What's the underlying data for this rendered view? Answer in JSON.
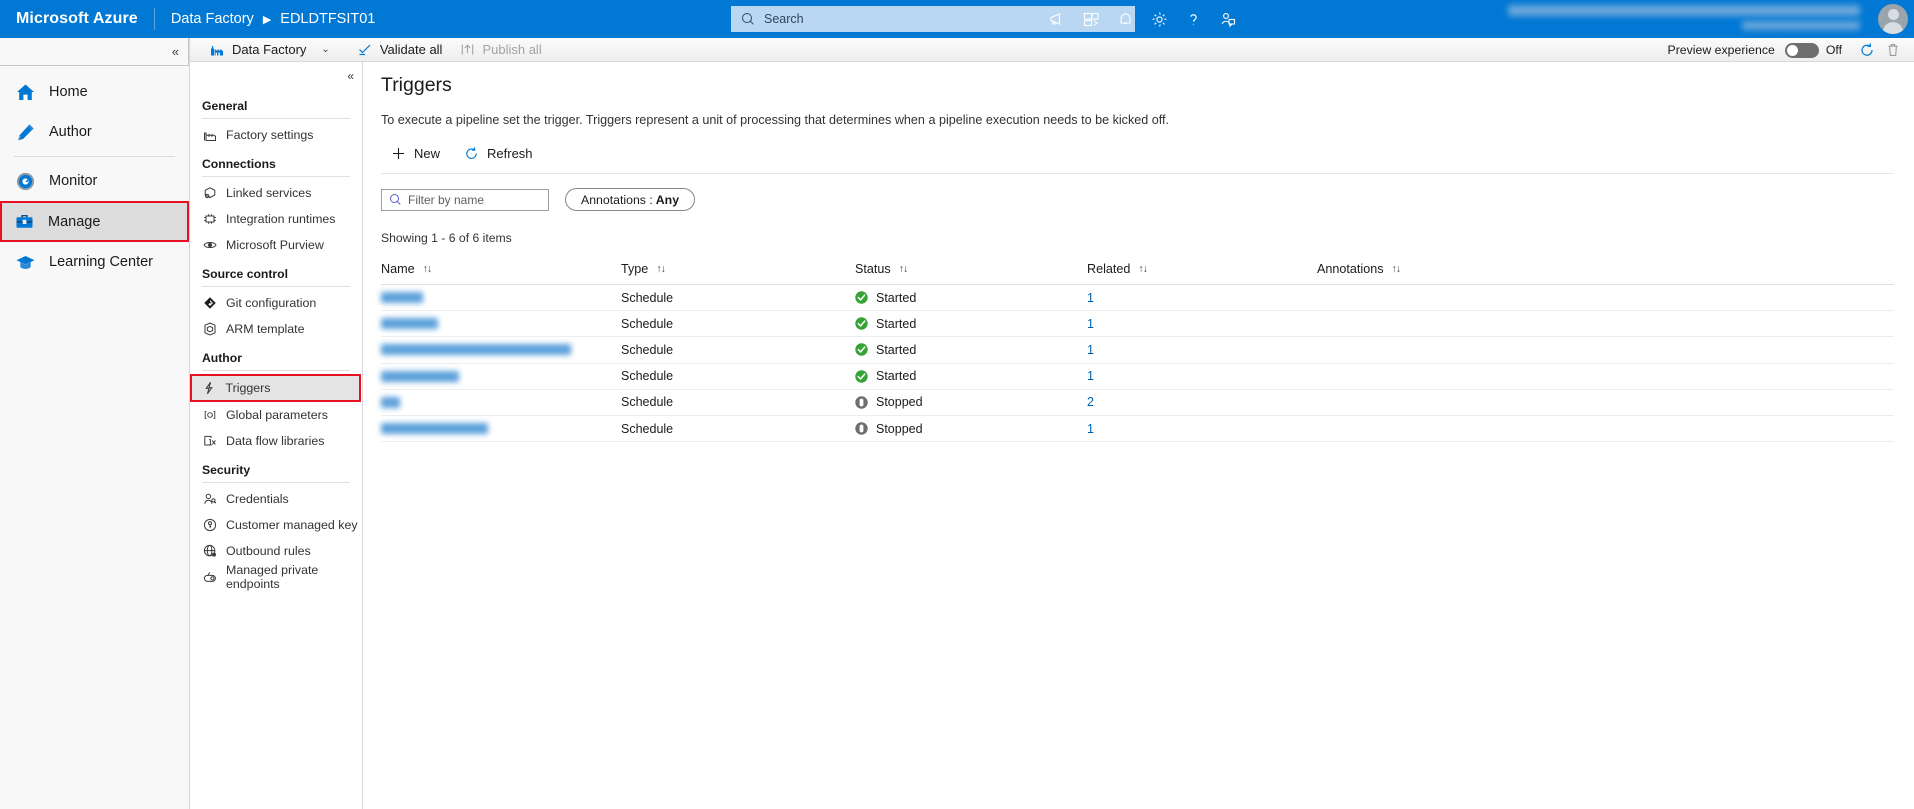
{
  "header": {
    "brand": "Microsoft Azure",
    "breadcrumb_service": "Data Factory",
    "breadcrumb_sep": "▶",
    "breadcrumb_resource": "EDLDTFSIT01",
    "search_placeholder": "Search",
    "icons": [
      {
        "name": "feedback-icon",
        "label": "Feedback"
      },
      {
        "name": "cloud-shell-icon",
        "label": "Cloud Shell"
      },
      {
        "name": "notifications-bell-icon",
        "label": "Notifications"
      },
      {
        "name": "settings-gear-icon",
        "label": "Settings"
      },
      {
        "name": "help-question-icon",
        "label": "Help"
      },
      {
        "name": "support-person-icon",
        "label": "Support"
      }
    ]
  },
  "leftnav": {
    "collapse_chevron": "«",
    "items": [
      {
        "label": "Home",
        "icon": "home-icon"
      },
      {
        "label": "Author",
        "icon": "pencil-icon"
      },
      {
        "label": "Monitor",
        "icon": "monitor-gauge-icon"
      },
      {
        "label": "Manage",
        "icon": "toolbox-icon",
        "selected": true
      },
      {
        "label": "Learning Center",
        "icon": "graduation-cap-icon"
      }
    ]
  },
  "panel": {
    "collapse_chevron": "«",
    "groups": [
      {
        "title": "General",
        "items": [
          {
            "label": "Factory settings",
            "icon": "factory-icon"
          }
        ]
      },
      {
        "title": "Connections",
        "items": [
          {
            "label": "Linked services",
            "icon": "linked-services-icon"
          },
          {
            "label": "Integration runtimes",
            "icon": "integration-runtime-icon"
          },
          {
            "label": "Microsoft Purview",
            "icon": "purview-eye-icon"
          }
        ]
      },
      {
        "title": "Source control",
        "items": [
          {
            "label": "Git configuration",
            "icon": "git-diamond-icon"
          },
          {
            "label": "ARM template",
            "icon": "arm-template-cube-icon"
          }
        ]
      },
      {
        "title": "Author",
        "items": [
          {
            "label": "Triggers",
            "icon": "lightning-bolt-icon",
            "selected": true
          },
          {
            "label": "Global parameters",
            "icon": "global-parameter-icon"
          },
          {
            "label": "Data flow libraries",
            "icon": "data-flow-library-icon"
          }
        ]
      },
      {
        "title": "Security",
        "items": [
          {
            "label": "Credentials",
            "icon": "credentials-person-key-icon"
          },
          {
            "label": "Customer managed key",
            "icon": "key-shield-icon"
          },
          {
            "label": "Outbound rules",
            "icon": "globe-outbound-icon"
          },
          {
            "label": "Managed private endpoints",
            "icon": "private-endpoint-icon"
          }
        ]
      }
    ]
  },
  "commandbar": {
    "data_factory_label": "Data Factory",
    "chevron": "⌄",
    "validate_all": "Validate all",
    "publish_all": "Publish all",
    "preview_experience_label": "Preview experience",
    "preview_state": "Off",
    "refresh_icon": "refresh-circle-icon",
    "discard_icon": "trash-icon"
  },
  "main": {
    "title": "Triggers",
    "description": "To execute a pipeline set the trigger. Triggers represent a unit of processing that determines when a pipeline execution needs to be kicked off.",
    "actions": [
      {
        "label": "New",
        "icon": "plus-icon"
      },
      {
        "label": "Refresh",
        "icon": "refresh-circle-icon"
      }
    ],
    "filter_placeholder": "Filter by name",
    "annotations_filter_label": "Annotations :",
    "annotations_filter_value": "Any",
    "showing": "Showing 1 - 6 of 6 items",
    "table": {
      "columns": [
        {
          "label": "Name",
          "sortable": true
        },
        {
          "label": "Type",
          "sortable": true
        },
        {
          "label": "Status",
          "sortable": true
        },
        {
          "label": "Related",
          "sortable": true
        },
        {
          "label": "Annotations",
          "sortable": true
        }
      ],
      "rows": [
        {
          "name": "",
          "name_redacted": true,
          "name_width": 42,
          "type": "Schedule",
          "status": "Started",
          "related": "1",
          "annotations": ""
        },
        {
          "name": "",
          "name_redacted": true,
          "name_width": 57,
          "type": "Schedule",
          "status": "Started",
          "related": "1",
          "annotations": ""
        },
        {
          "name": "",
          "name_redacted": true,
          "name_width": 190,
          "type": "Schedule",
          "status": "Started",
          "related": "1",
          "annotations": ""
        },
        {
          "name": "",
          "name_redacted": true,
          "name_width": 78,
          "type": "Schedule",
          "status": "Started",
          "related": "1",
          "annotations": ""
        },
        {
          "name": "",
          "name_redacted": true,
          "name_width": 19,
          "type": "Schedule",
          "status": "Stopped",
          "related": "2",
          "annotations": ""
        },
        {
          "name": "",
          "name_redacted": true,
          "name_width": 107,
          "type": "Schedule",
          "status": "Stopped",
          "related": "1",
          "annotations": ""
        }
      ]
    }
  },
  "colors": {
    "azure_blue": "#0078d4",
    "highlight_red": "#e81123",
    "status_started_green": "#107c10",
    "status_stopped_gray": "#767676",
    "link_blue": "#0062ad"
  }
}
